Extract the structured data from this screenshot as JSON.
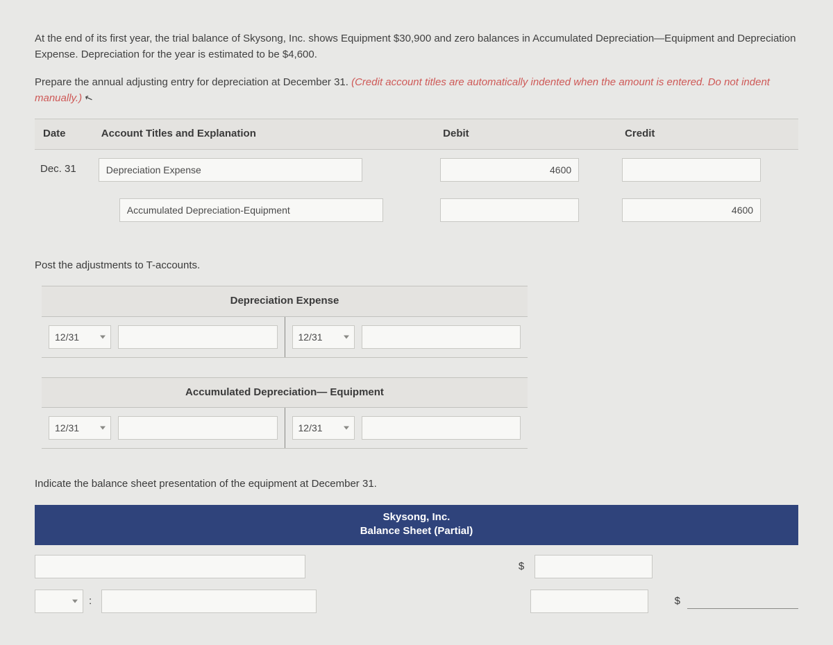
{
  "intro": {
    "p1": "At the end of its first year, the trial balance of Skysong, Inc. shows Equipment $30,900 and zero balances in Accumulated Depreciation—Equipment and Depreciation Expense. Depreciation for the year is estimated to be $4,600.",
    "p2a": "Prepare the annual adjusting entry for depreciation at December 31. ",
    "p2b": "(Credit account titles are automatically indented when the amount is entered. Do not indent manually.)"
  },
  "journal": {
    "headers": {
      "date": "Date",
      "account": "Account Titles and Explanation",
      "debit": "Debit",
      "credit": "Credit"
    },
    "rows": [
      {
        "date": "Dec. 31",
        "account": "Depreciation Expense",
        "debit": "4600",
        "credit": ""
      },
      {
        "date": "",
        "account": "Accumulated Depreciation-Equipment",
        "debit": "",
        "credit": "4600"
      }
    ]
  },
  "taccounts": {
    "intro": "Post the adjustments to T-accounts.",
    "accounts": [
      {
        "title": "Depreciation Expense",
        "left": {
          "date": "12/31",
          "amount": ""
        },
        "right": {
          "date": "12/31",
          "amount": ""
        }
      },
      {
        "title": "Accumulated Depreciation— Equipment",
        "left": {
          "date": "12/31",
          "amount": ""
        },
        "right": {
          "date": "12/31",
          "amount": ""
        }
      }
    ]
  },
  "balanceSheet": {
    "intro": "Indicate the balance sheet presentation of the equipment at December 31.",
    "company": "Skysong, Inc.",
    "title": "Balance Sheet (Partial)",
    "currency": "$",
    "colon": ":"
  }
}
